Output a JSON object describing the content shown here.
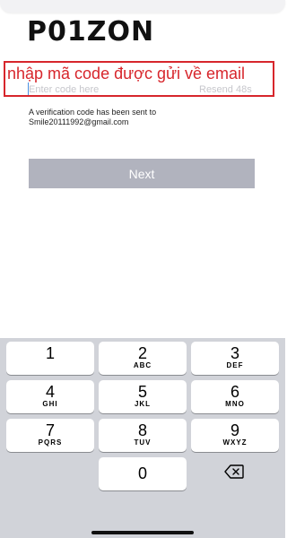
{
  "app": {
    "logo": "P01ZON"
  },
  "annotation": {
    "text": "nhập mã code được gửi về email"
  },
  "form": {
    "code_placeholder": "Enter code here",
    "resend_label": "Resend 48s",
    "info_line1": "A verification code has been sent to",
    "info_email": "Smile20111992@gmail.com",
    "next_label": "Next"
  },
  "keyboard": {
    "keys": [
      {
        "digit": "1",
        "letters": ""
      },
      {
        "digit": "2",
        "letters": "ABC"
      },
      {
        "digit": "3",
        "letters": "DEF"
      },
      {
        "digit": "4",
        "letters": "GHI"
      },
      {
        "digit": "5",
        "letters": "JKL"
      },
      {
        "digit": "6",
        "letters": "MNO"
      },
      {
        "digit": "7",
        "letters": "PQRS"
      },
      {
        "digit": "8",
        "letters": "TUV"
      },
      {
        "digit": "9",
        "letters": "WXYZ"
      },
      {
        "digit": "0",
        "letters": ""
      }
    ],
    "backspace_icon": "backspace-icon"
  },
  "colors": {
    "annotation": "#d7262c",
    "button_disabled": "#b1b3be",
    "keyboard_bg": "#d1d3d9"
  }
}
